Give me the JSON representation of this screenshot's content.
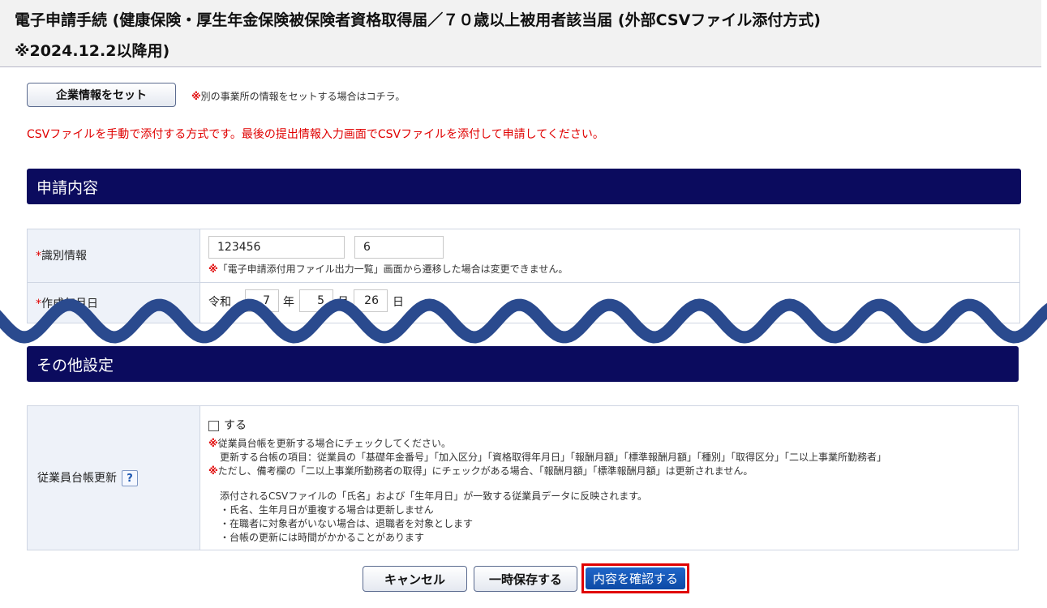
{
  "header": {
    "title": "電子申請手続 (健康保険・厚生年金保険被保険者資格取得届／７０歳以上被用者該当届 (外部CSVファイル添付方式)\n※2024.12.2以降用)"
  },
  "company": {
    "button_label": "企業情報をセット",
    "note_mark": "※",
    "note_text": "別の事業所の情報をセットする場合はコチラ。"
  },
  "notice": "CSVファイルを手動で添付する方式です。最後の提出情報入力画面でCSVファイルを添付して申請してください。",
  "section1": {
    "title": "申請内容",
    "id_info": {
      "required_mark": "*",
      "label": "識別情報",
      "value1": "123456",
      "value2": "6",
      "note_mark": "※",
      "note": "「電子申請添付用ファイル出力一覧」画面から遷移した場合は変更できません。"
    },
    "date": {
      "required_mark": "*",
      "label": "作成年月日",
      "era": "令和",
      "year": "7",
      "year_unit": "年",
      "month": "5",
      "month_unit": "月",
      "day": "26",
      "day_unit": "日"
    }
  },
  "section2": {
    "title": "その他設定",
    "ledger": {
      "label": "従業員台帳更新",
      "help": "?",
      "checkbox_label": "する",
      "checked": false,
      "note_mark": "※",
      "note1": "従業員台帳を更新する場合にチェックしてください。",
      "note2": "更新する台帳の項目：従業員の「基礎年金番号」「加入区分」「資格取得年月日」「報酬月額」「標準報酬月額」「種別」「取得区分」「二以上事業所勤務者」",
      "note3": "ただし、備考欄の「二以上事業所勤務者の取得」にチェックがある場合、「報酬月額」「標準報酬月額」は更新されません。",
      "detail": "添付されるCSVファイルの「氏名」および「生年月日」が一致する従業員データに反映されます。",
      "bullets": [
        "・氏名、生年月日が重複する場合は更新しません",
        "・在職者に対象者がいない場合は、退職者を対象とします",
        "・台帳の更新には時間がかかることがあります"
      ]
    }
  },
  "buttons": {
    "cancel": "キャンセル",
    "save_draft": "一時保存する",
    "confirm": "内容を確認する"
  },
  "colors": {
    "section_bar": "#0b0b5e",
    "notice_red": "#e00000",
    "wave": "#2a4a8e",
    "confirm_button": "#1f66c9",
    "highlight_border": "#e00000"
  }
}
